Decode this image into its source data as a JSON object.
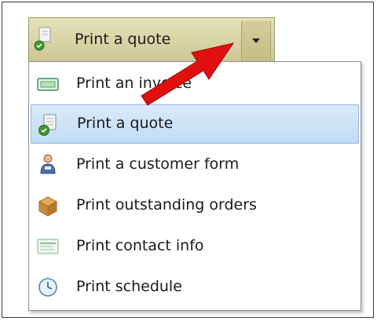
{
  "split_button": {
    "label": "Print a quote",
    "icon": "quote-document-icon"
  },
  "menu": {
    "items": [
      {
        "label": "Print an invoice",
        "icon": "invoice-icon",
        "selected": false
      },
      {
        "label": "Print a quote",
        "icon": "quote-document-icon",
        "selected": true
      },
      {
        "label": "Print a customer form",
        "icon": "customer-icon",
        "selected": false
      },
      {
        "label": "Print outstanding orders",
        "icon": "package-icon",
        "selected": false
      },
      {
        "label": "Print contact info",
        "icon": "contact-card-icon",
        "selected": false
      },
      {
        "label": "Print schedule",
        "icon": "clock-icon",
        "selected": false
      }
    ]
  },
  "colors": {
    "button_face": "#d9d4a6",
    "selected_highlight": "#c3dcf5",
    "annotation_arrow": "#e01010"
  }
}
